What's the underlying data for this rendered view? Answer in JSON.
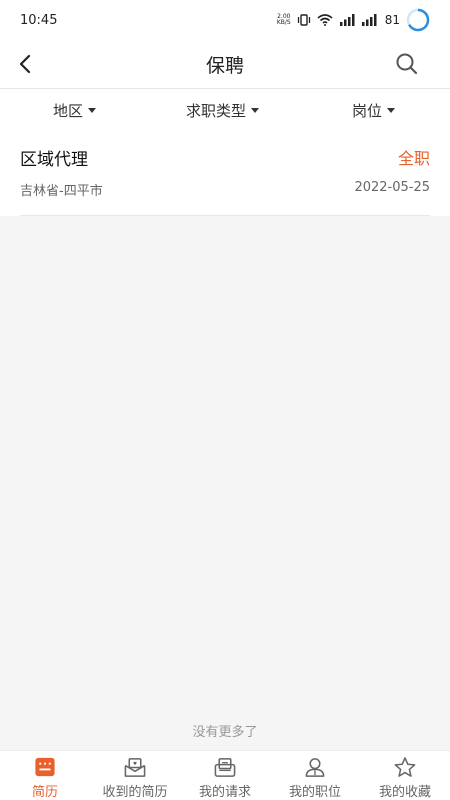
{
  "status_bar": {
    "time": "10:45",
    "net_speed_value": "2.00",
    "net_speed_unit": "KB/S",
    "battery": "81"
  },
  "header": {
    "title": "保聘",
    "back_icon": "chevron-left-icon",
    "search_icon": "search-icon"
  },
  "filters": [
    {
      "label": "地区"
    },
    {
      "label": "求职类型"
    },
    {
      "label": "岗位"
    }
  ],
  "jobs": [
    {
      "title": "区域代理",
      "type": "全职",
      "location": "吉林省-四平市",
      "date": "2022-05-25"
    }
  ],
  "footer_text": "没有更多了",
  "tabs": [
    {
      "label": "简历",
      "icon": "resume-icon",
      "active": true
    },
    {
      "label": "收到的简历",
      "icon": "inbox-resume-icon",
      "active": false
    },
    {
      "label": "我的请求",
      "icon": "request-icon",
      "active": false
    },
    {
      "label": "我的职位",
      "icon": "position-icon",
      "active": false
    },
    {
      "label": "我的收藏",
      "icon": "star-icon",
      "active": false
    }
  ],
  "colors": {
    "accent": "#e8612c",
    "background": "#f5f5f5",
    "text": "#222222",
    "muted": "#666666"
  }
}
